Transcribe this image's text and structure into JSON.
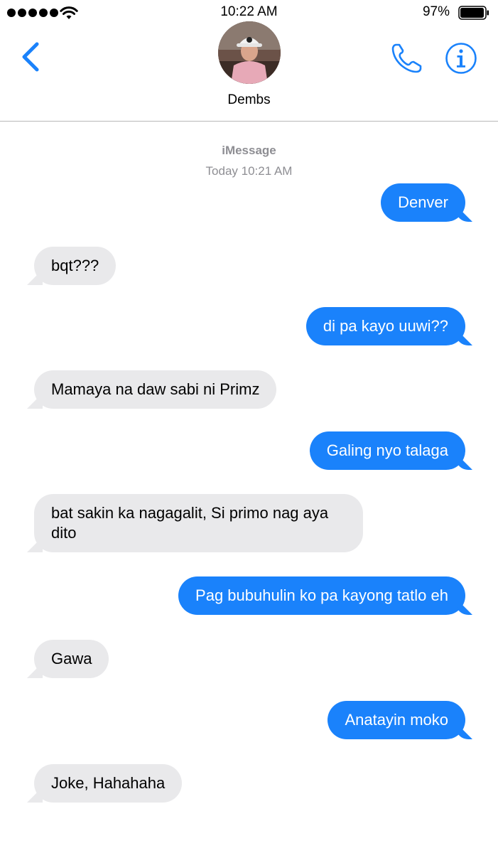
{
  "status_bar": {
    "time": "10:22 AM",
    "battery_percent": "97%"
  },
  "header": {
    "contact_name": "Dembs",
    "accent_color": "#1a82fb"
  },
  "thread": {
    "service": "iMessage",
    "timestamp": "Today 10:21 AM",
    "messages": [
      {
        "direction": "sent",
        "text": "Denver"
      },
      {
        "direction": "received",
        "text": "bqt???"
      },
      {
        "direction": "sent",
        "text": "di pa kayo uuwi??"
      },
      {
        "direction": "received",
        "text": "Mamaya na daw sabi ni Primz"
      },
      {
        "direction": "sent",
        "text": "Galing nyo talaga"
      },
      {
        "direction": "received",
        "text": "bat sakin ka nagagalit, Si primo nag aya dito"
      },
      {
        "direction": "sent",
        "text": "Pag bubuhulin ko pa kayong tatlo eh"
      },
      {
        "direction": "received",
        "text": "Gawa"
      },
      {
        "direction": "sent",
        "text": "Anatayin moko"
      },
      {
        "direction": "received",
        "text": "Joke, Hahahaha"
      }
    ]
  },
  "colors": {
    "sent_bubble": "#1a82fb",
    "received_bubble": "#e9e9eb",
    "meta_text": "#8e8e93"
  },
  "icons": [
    "signal-icon",
    "wifi-icon",
    "battery-icon",
    "back-chevron-icon",
    "phone-icon",
    "info-icon"
  ]
}
